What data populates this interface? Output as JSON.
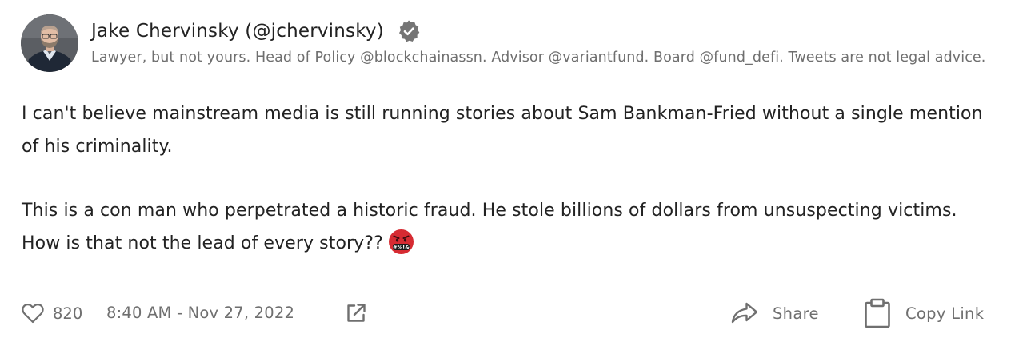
{
  "tweet": {
    "author": {
      "display_name": "Jake Chervinsky (@jchervinsky)",
      "bio": "Lawyer, but not yours. Head of Policy @blockchainassn. Advisor @variantfund. Board @fund_defi. Tweets are not legal advice.",
      "verified": true,
      "avatar_icon": "profile-photo"
    },
    "body": {
      "paragraph_1": "I can't believe mainstream media is still running stories about Sam Bankman-Fried without a single mention of his criminality.",
      "paragraph_2": "This is a con man who perpetrated a historic fraud. He stole billions of dollars from unsuspecting victims. How is that not the lead of every story??",
      "emoji": "face-with-symbols-on-mouth"
    },
    "footer": {
      "like_icon": "heart-outline-icon",
      "like_count": "820",
      "timestamp": "8:40 AM - Nov 27, 2022",
      "open_icon": "external-link-icon",
      "share_icon": "share-arrow-icon",
      "share_label": "Share",
      "copy_icon": "clipboard-icon",
      "copy_label": "Copy Link"
    }
  },
  "colors": {
    "primary_text": "#222222",
    "secondary_text": "#6f6f6f",
    "icon_gray": "#6f6f6f",
    "verified_badge": "#757575",
    "emoji_red": "#d62b32",
    "background": "#ffffff"
  }
}
